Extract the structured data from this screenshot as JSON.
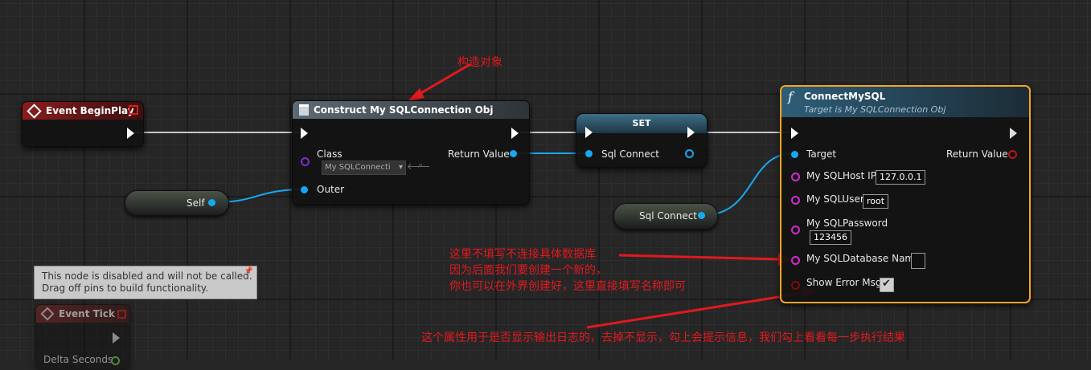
{
  "nodes": {
    "begin_play": {
      "title": "Event BeginPlay"
    },
    "construct": {
      "title": "Construct My SQLConnection Obj",
      "class_label": "Class",
      "class_value": "My SQLConnecti",
      "return_label": "Return Value",
      "outer_label": "Outer"
    },
    "self": {
      "label": "Self"
    },
    "set": {
      "title": "SET",
      "pin_label": "Sql Connect"
    },
    "sql_connect_var": {
      "label": "Sql Connect"
    },
    "connect": {
      "title": "ConnectMySQL",
      "subtitle": "Target is My SQLConnection Obj",
      "target_label": "Target",
      "return_label": "Return Value",
      "host_label": "My SQLHost IP",
      "host_value": "127.0.0.1",
      "user_label": "My SQLUser",
      "user_value": "root",
      "password_label": "My SQLPassword",
      "password_value": "123456",
      "dbname_label": "My SQLDatabase Name",
      "dbname_value": "",
      "showerr_label": "Show Error Msg",
      "showerr_checked": true
    },
    "event_tick": {
      "title": "Event Tick",
      "delta_label": "Delta Seconds",
      "tooltip_line1": "This node is disabled and will not be called.",
      "tooltip_line2": "Drag off pins to build functionality."
    }
  },
  "annotations": {
    "construct": "构造对象",
    "db_line1": "这里不填写不连接具体数据库",
    "db_line2": "因为后面我们要创建一个新的，",
    "db_line3": "你也可以在外界创建好，这里直接填写名称即可",
    "showerr": "这个属性用于是否显示输出日志的，去掉不显示，勾上会提示信息，我们勾上看看每一步执行结果"
  },
  "colors": {
    "event_header": "#8a1c1c",
    "function_header": "#2e5d78",
    "set_header": "#3a6f8a",
    "annotation": "#e2191f",
    "object_pin": "#17a9f0",
    "selection": "#f5a623"
  }
}
